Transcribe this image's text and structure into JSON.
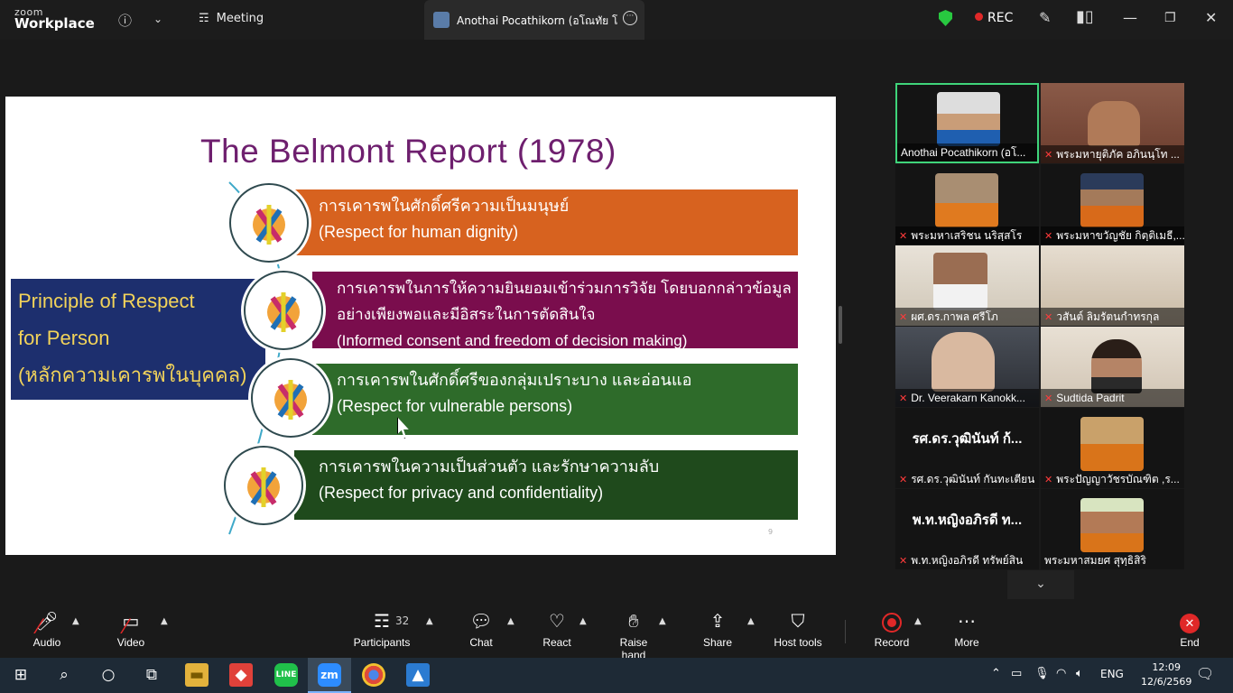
{
  "app": {
    "logo_line1": "zoom",
    "logo_line2": "Workplace"
  },
  "titlebar": {
    "meeting_tab": "Meeting",
    "active_tab": "Anothai Pocathikorn (อโณทัย โภคา",
    "rec_label": "REC",
    "accent_green": "#28c840",
    "rec_red": "#e02828"
  },
  "slide": {
    "title": "The Belmont Report (1978)",
    "principle_lines": [
      "Principle of Respect",
      "for Person",
      "(หลักความเคารพในบุคคล)"
    ],
    "items": [
      {
        "thai": "การเคารพในศักดิ์ศรีความเป็นมนุษย์",
        "en": "(Respect for human dignity)",
        "color": "#d7621f"
      },
      {
        "thai": "การเคารพในการให้ความยินยอมเข้าร่วมการวิจัย โดยบอกกล่าวข้อมูล",
        "thai2": "อย่างเพียงพอและมีอิสระในการตัดสินใจ",
        "en": "(Informed consent and freedom of decision making)",
        "color": "#7a0d4d"
      },
      {
        "thai": "การเคารพในศักดิ์ศรีของกลุ่มเปราะบาง และอ่อนแอ",
        "en": "(Respect for vulnerable persons)",
        "color": "#2e6b2a"
      },
      {
        "thai": "การเคารพในความเป็นส่วนตัว  และรักษาความลับ",
        "en": "(Respect for privacy and confidentiality)",
        "color": "#1f4a1c"
      }
    ],
    "page_number": "9"
  },
  "gallery": [
    {
      "name": "Anothai Pocathikorn (อโ...",
      "muted": false,
      "active": true
    },
    {
      "name": "พระมหายุติภัค อภินนฺโท ...",
      "muted": true
    },
    {
      "name": "พระมหาเสริชน นริสฺสโร",
      "muted": true
    },
    {
      "name": "พระมหาขวัญชัย กิตฺติเมธี,...",
      "muted": true
    },
    {
      "name": "ผศ.ดร.กาพล ศรีโภ",
      "muted": true
    },
    {
      "name": "วสันต์ ลิมรัตนกำทรกุล",
      "muted": true
    },
    {
      "name": "Dr. Veerakarn Kanokk...",
      "muted": true
    },
    {
      "name": "Sudtida Padrit",
      "muted": true
    },
    {
      "name": "รศ.ดร.วุฒินันท์ กันทะเตียน",
      "muted": true,
      "big_name": "รศ.ดร.วุฒินันท์ ก้..."
    },
    {
      "name": "พระปัญญาวัชรบัณฑิต ,ร...",
      "muted": true
    },
    {
      "name": "พ.ท.หญิงอภิรดี ทรัพย์สิน",
      "muted": true,
      "big_name": "พ.ท.หญิงอภิรดี ท..."
    },
    {
      "name": "พระมหาสมยศ สุทฺธิสิริ",
      "muted": false
    }
  ],
  "toolbar": {
    "audio": "Audio",
    "video": "Video",
    "participants": "Participants",
    "participants_count": "32",
    "chat": "Chat",
    "react": "React",
    "raise_hand": "Raise hand",
    "share": "Share",
    "host_tools": "Host tools",
    "record": "Record",
    "more": "More",
    "end": "End"
  },
  "taskbar": {
    "language": "ENG",
    "time": "12:09",
    "date": "12/6/2569"
  }
}
